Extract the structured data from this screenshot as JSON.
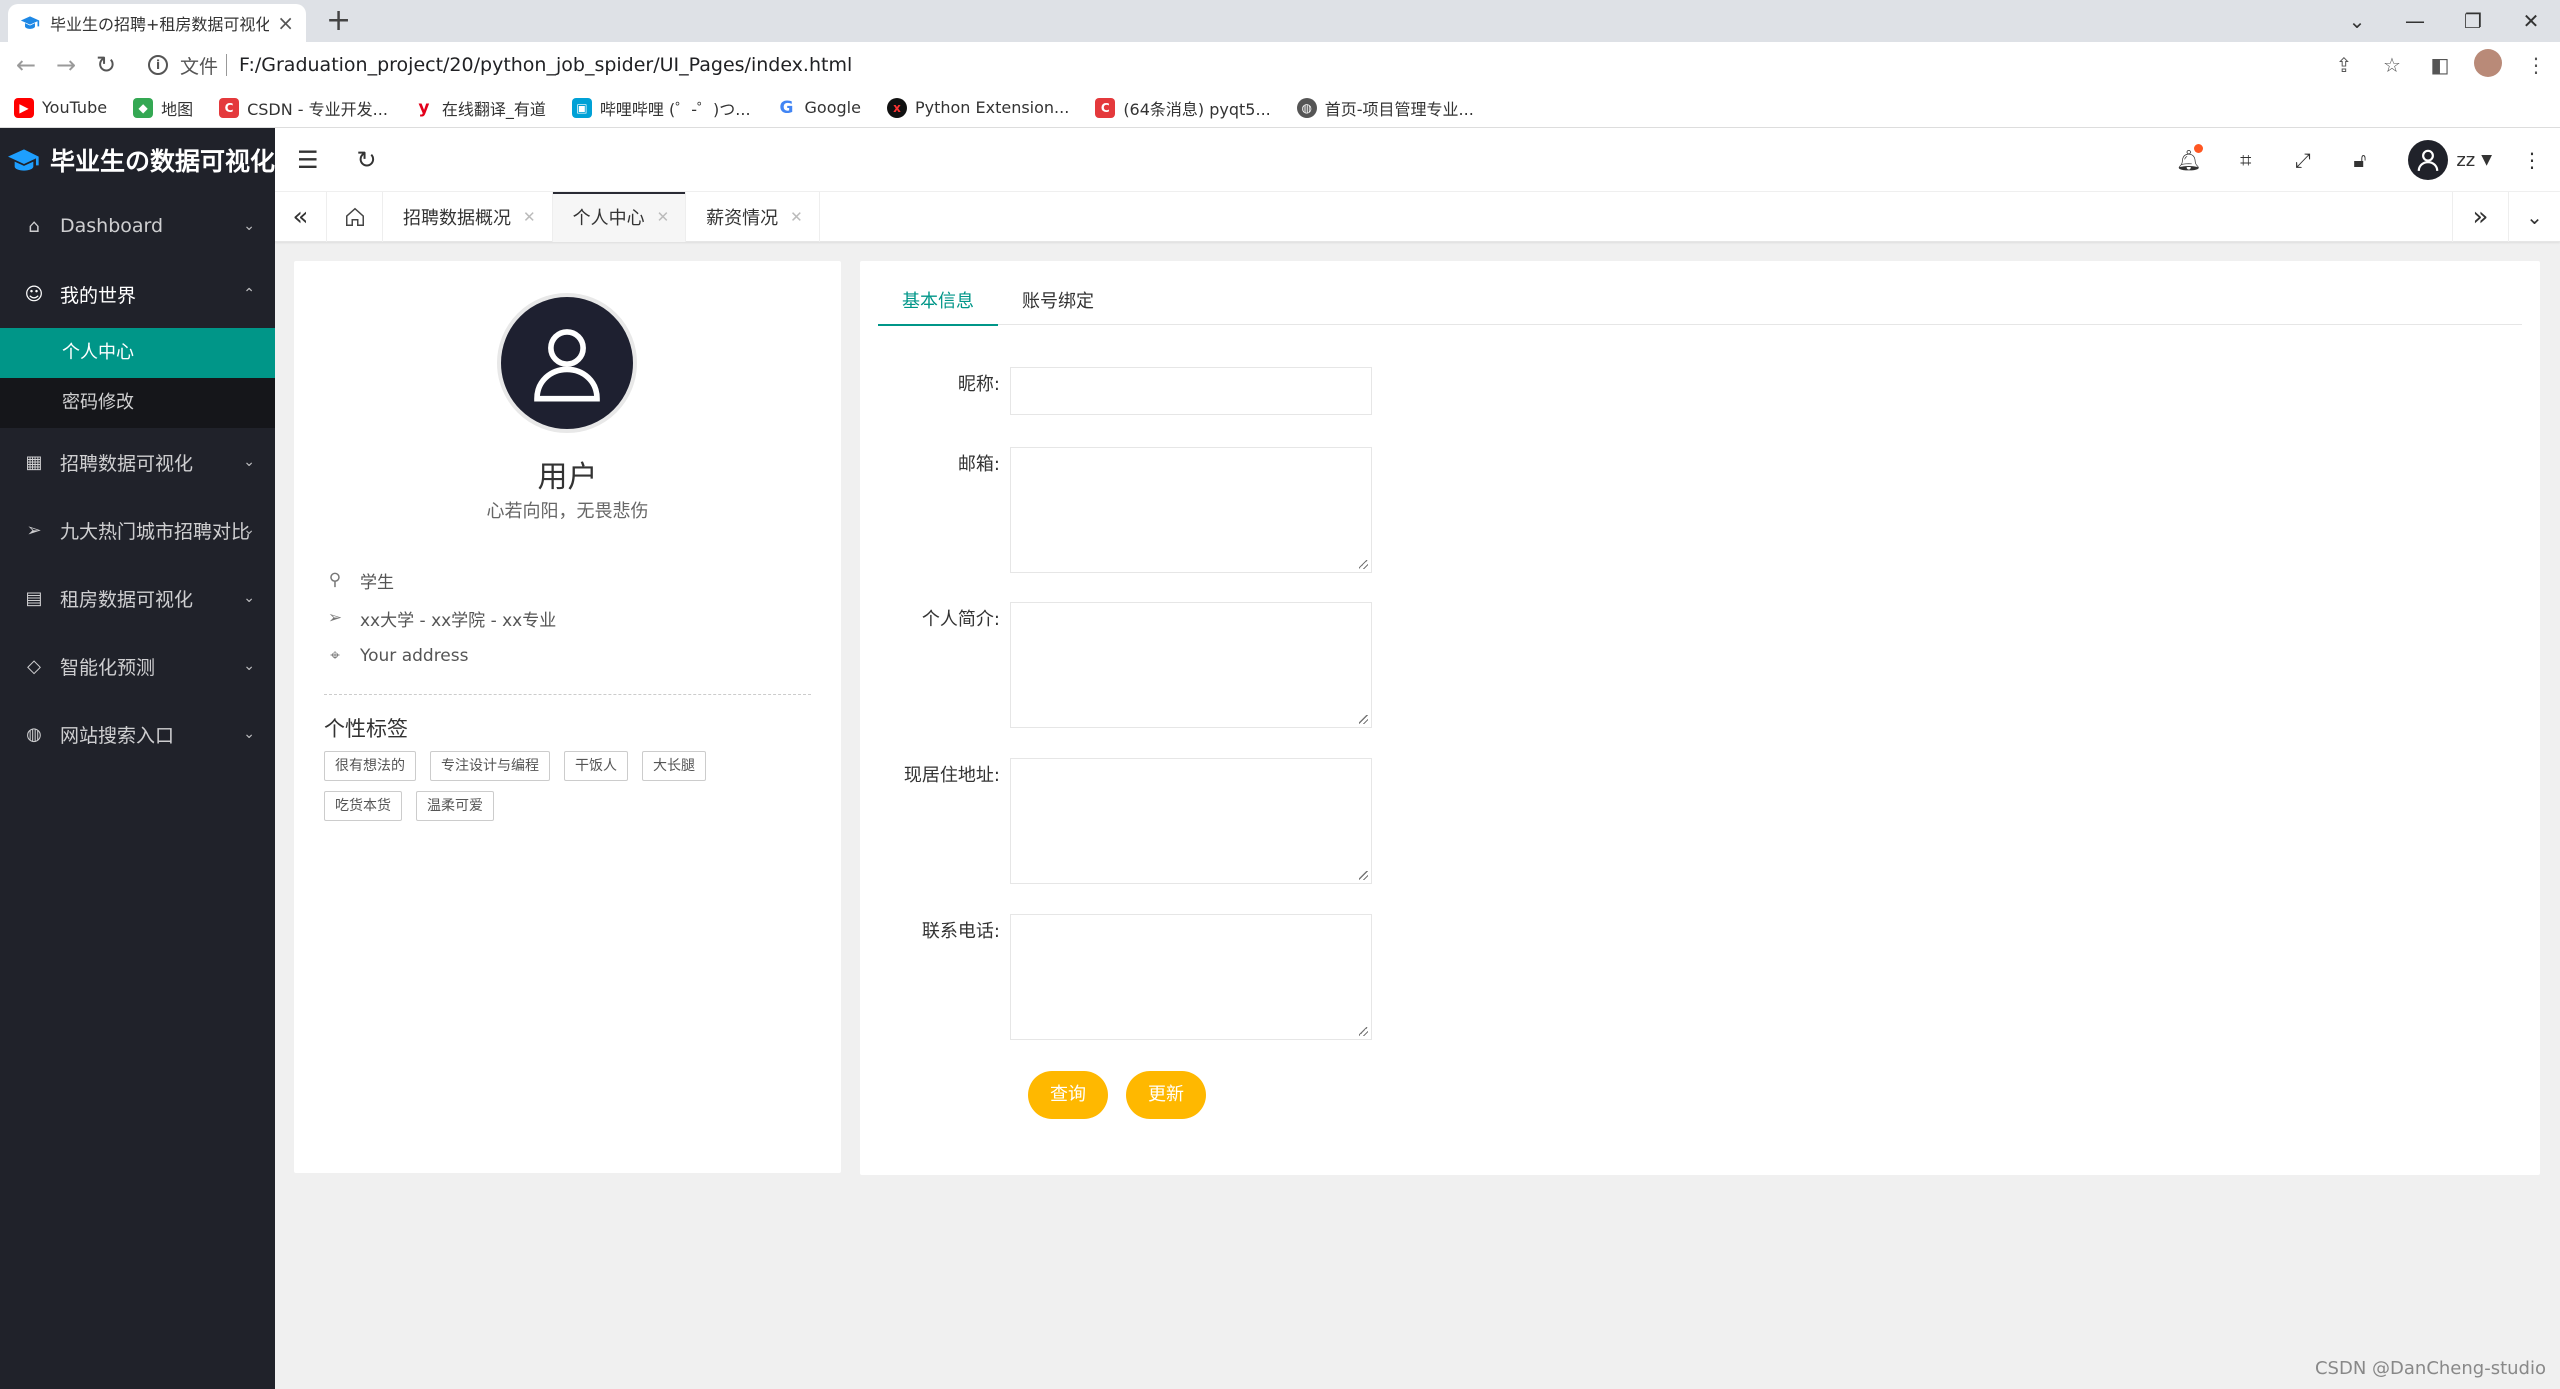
{
  "browser": {
    "tab_title": "毕业生の招聘+租房数据可视化系",
    "url_label": "文件",
    "url": "F:/Graduation_project/20/python_job_spider/UI_Pages/index.html",
    "bookmarks": [
      {
        "label": "YouTube",
        "icon": "youtube-icon",
        "color": "#ff0000"
      },
      {
        "label": "地图",
        "icon": "maps-icon",
        "color": "#34a853"
      },
      {
        "label": "CSDN - 专业开发...",
        "icon": "csdn-icon",
        "color": "#e4393c"
      },
      {
        "label": "在线翻译_有道",
        "icon": "youdao-icon",
        "color": "#e3001b"
      },
      {
        "label": "哔哩哔哩 (゜-゜)つ...",
        "icon": "bilibili-icon",
        "color": "#00a1d6"
      },
      {
        "label": "Google",
        "icon": "google-icon",
        "color": "#4285f4"
      },
      {
        "label": "Python Extension...",
        "icon": "python-ext-icon",
        "color": "#111111"
      },
      {
        "label": "(64条消息) pyqt5...",
        "icon": "csdn-icon",
        "color": "#e4393c"
      },
      {
        "label": "首页-项目管理专业...",
        "icon": "globe-icon",
        "color": "#555555"
      }
    ]
  },
  "app": {
    "logo_text": "毕业生の数据可视化",
    "username": "zz",
    "accent": "#009688",
    "sidebar_bg": "#20222a",
    "button_color": "#ffb800"
  },
  "sidebar": {
    "items": [
      {
        "label": "Dashboard",
        "icon": "home-icon"
      },
      {
        "label": "我的世界",
        "icon": "smile-icon",
        "open": true,
        "children": [
          {
            "label": "个人中心",
            "active": true
          },
          {
            "label": "密码修改"
          }
        ]
      },
      {
        "label": "招聘数据可视化",
        "icon": "calendar-icon"
      },
      {
        "label": "九大热门城市招聘对比",
        "icon": "send-icon"
      },
      {
        "label": "租房数据可视化",
        "icon": "read-icon"
      },
      {
        "label": "智能化预测",
        "icon": "diamond-icon"
      },
      {
        "label": "网站搜索入口",
        "icon": "globe-icon"
      }
    ]
  },
  "page_tabs": [
    {
      "label": "招聘数据概况"
    },
    {
      "label": "个人中心",
      "active": true
    },
    {
      "label": "薪资情况"
    }
  ],
  "profile": {
    "name": "用户",
    "motto": "心若向阳，无畏悲伤",
    "role": "学生",
    "school": "xx大学 - xx学院 - xx专业",
    "address": "Your address",
    "tags_title": "个性标签",
    "tags": [
      "很有想法的",
      "专注设计与编程",
      "干饭人",
      "大长腿",
      "吃货本货",
      "温柔可爱"
    ]
  },
  "form": {
    "tabs": [
      "基本信息",
      "账号绑定"
    ],
    "fields": {
      "nickname": {
        "label": "昵称:",
        "value": ""
      },
      "email": {
        "label": "邮箱:",
        "value": ""
      },
      "bio": {
        "label": "个人简介:",
        "value": ""
      },
      "address": {
        "label": "现居住地址:",
        "value": ""
      },
      "phone": {
        "label": "联系电话:",
        "value": ""
      }
    },
    "query_label": "查询",
    "update_label": "更新"
  },
  "watermark": "CSDN @DanCheng-studio"
}
